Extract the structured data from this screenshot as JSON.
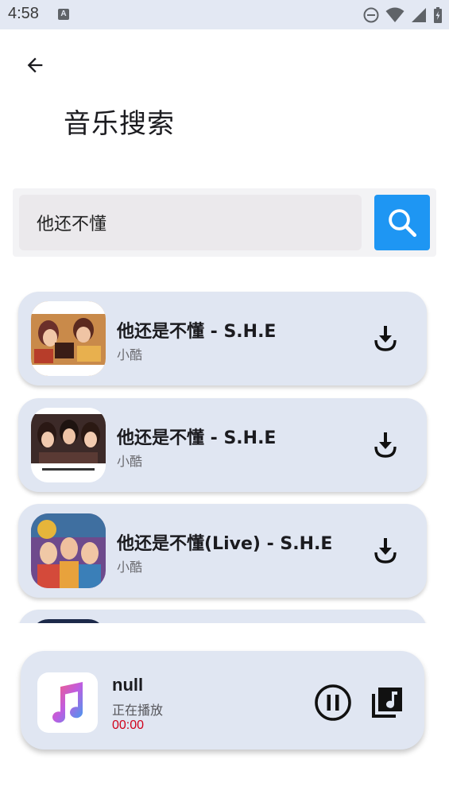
{
  "status_bar": {
    "time": "4:58",
    "notification_icon": "a-keyboard-icon",
    "icons": [
      "do-not-disturb-icon",
      "wifi-icon",
      "cell-signal-icon",
      "battery-icon"
    ]
  },
  "header": {
    "back_icon": "arrow-back-icon",
    "title": "音乐搜索"
  },
  "search": {
    "query": "他还不懂",
    "button_icon": "search-icon",
    "accent": "#1e96f3"
  },
  "results": [
    {
      "title": "他还是不懂 - S.H.E",
      "artist": "小酷",
      "action_icon": "download-icon"
    },
    {
      "title": "他还是不懂 - S.H.E",
      "artist": "小酷",
      "action_icon": "download-icon"
    },
    {
      "title": "他还是不懂(Live) - S.H.E",
      "artist": "小酷",
      "action_icon": "download-icon"
    },
    {
      "title": "",
      "artist": "",
      "action_icon": "download-icon"
    }
  ],
  "player": {
    "art_icon": "music-note-icon",
    "title": "null",
    "status": "正在播放",
    "time": "00:00",
    "time_color": "#d0021b",
    "pause_icon": "pause-circle-icon",
    "queue_icon": "music-library-icon"
  },
  "colors": {
    "card_bg": "#e0e6f2",
    "status_bar_bg": "#e3e8f3"
  }
}
